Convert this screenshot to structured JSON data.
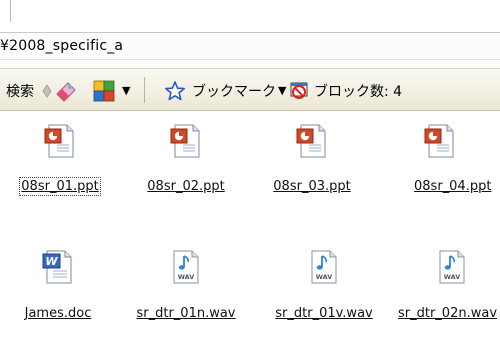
{
  "address": {
    "text": "¥2008_specific_a"
  },
  "toolbar": {
    "search_label": "検索",
    "bookmark_label": "ブックマーク",
    "block_label": "ブロック数: 4"
  },
  "files": [
    {
      "name": "08sr_01.ppt",
      "icon": "powerpoint-file-icon"
    },
    {
      "name": "08sr_02.ppt",
      "icon": "powerpoint-file-icon"
    },
    {
      "name": "08sr_03.ppt",
      "icon": "powerpoint-file-icon"
    },
    {
      "name": "08sr_04.ppt",
      "icon": "powerpoint-file-icon"
    },
    {
      "name": "James.doc",
      "icon": "word-file-icon"
    },
    {
      "name": "sr_dtr_01n.wav",
      "icon": "wav-audio-file-icon"
    },
    {
      "name": "sr_dtr_01v.wav",
      "icon": "wav-audio-file-icon"
    },
    {
      "name": "sr_dtr_02n.wav",
      "icon": "wav-audio-file-icon"
    }
  ],
  "icon_labels": {
    "wav": "WAV",
    "word": "W"
  }
}
